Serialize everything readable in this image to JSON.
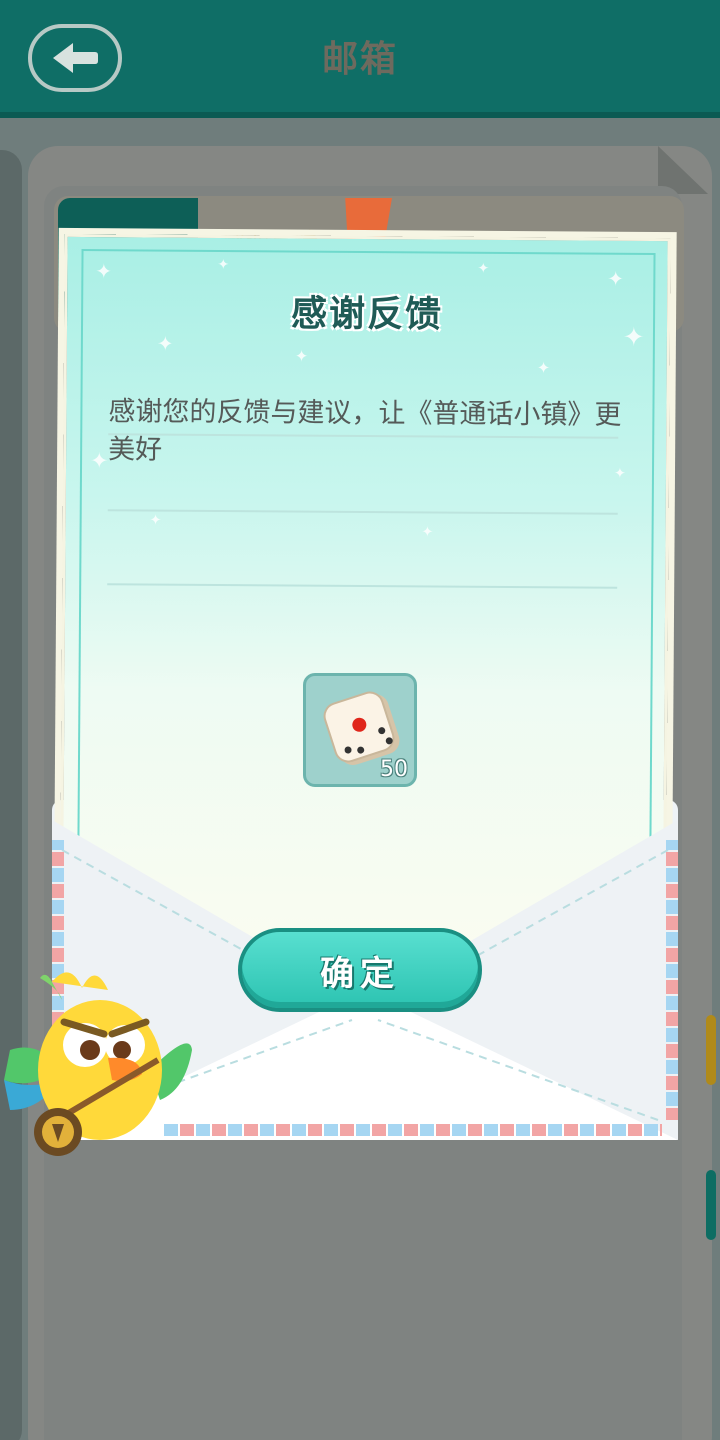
{
  "header": {
    "title": "邮箱",
    "back_icon": "arrow-left-icon"
  },
  "mail_list": {
    "items": [
      {
        "title": "感谢反馈"
      }
    ]
  },
  "dialog": {
    "title": "感谢反馈",
    "body": "感谢您的反馈与建议，让《普通话小镇》更美好",
    "reward": {
      "icon": "dice-icon",
      "count": "50"
    },
    "confirm_label": "确定"
  },
  "colors": {
    "header": "#0f6e66",
    "button": "#2cc3b1",
    "letter": "#c9f6ee"
  }
}
